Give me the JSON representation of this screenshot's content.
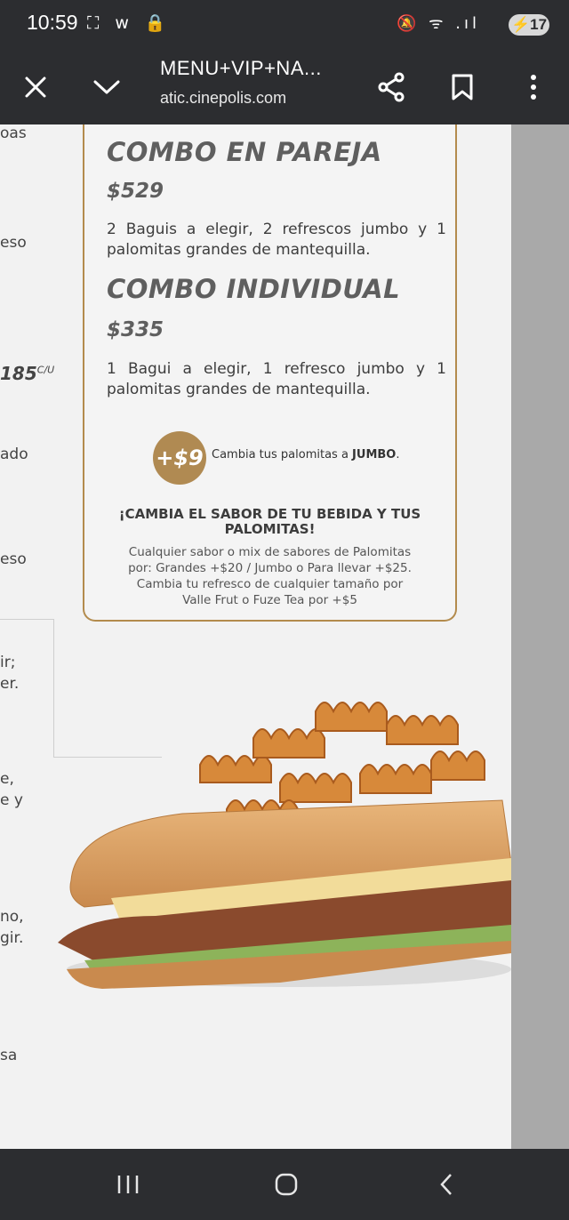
{
  "status_bar": {
    "time": "10:59",
    "left_icons": "⛶ w 🔒",
    "right_icons": "🔕 ᯤ .ıl",
    "battery": "17"
  },
  "toolbar": {
    "title": "MENU+VIP+NA...",
    "url_faded": "",
    "url": "atic.cinepolis.com"
  },
  "left_column_fragments": [
    {
      "text": "oas"
    },
    {
      "text": "eso"
    },
    {
      "text": "185",
      "sup": "C/U"
    },
    {
      "text": "ado"
    },
    {
      "text": "eso"
    },
    {
      "text": "ir;"
    },
    {
      "text": "er."
    },
    {
      "text": "e,"
    },
    {
      "text": "e y"
    },
    {
      "text": "no,"
    },
    {
      "text": "gir."
    },
    {
      "text": "sa"
    }
  ],
  "card": {
    "combo1_title": "COMBO EN PAREJA",
    "combo1_price": "$529",
    "combo1_desc": "2 Baguis a elegir, 2 refrescos jumbo y 1 palomitas grandes de mantequilla.",
    "combo2_title": "COMBO INDIVIDUAL",
    "combo2_price": "$335",
    "combo2_desc": "1 Bagui a elegir, 1 refresco jumbo y 1 palomitas grandes de mantequilla.",
    "upgrade_badge": "+$9",
    "upgrade_text_prefix": "Cambia tus palomitas a ",
    "upgrade_text_bold": "JUMBO",
    "upgrade_text_suffix": ".",
    "change_heading": "¡CAMBIA EL SABOR DE TU BEBIDA Y TUS PALOMITAS!",
    "change_line1": "Cualquier sabor o mix de sabores de Palomitas",
    "change_line2": "por: Grandes +$20 / Jumbo o Para llevar +$25.",
    "change_line3": "Cambia tu refresco de cualquier tamaño por",
    "change_line4": "Valle Frut o Fuze Tea por +$5"
  },
  "colors": {
    "bar_bg": "#2c2d30",
    "gold": "#b08a52",
    "title_gray": "#5f5f5f"
  }
}
